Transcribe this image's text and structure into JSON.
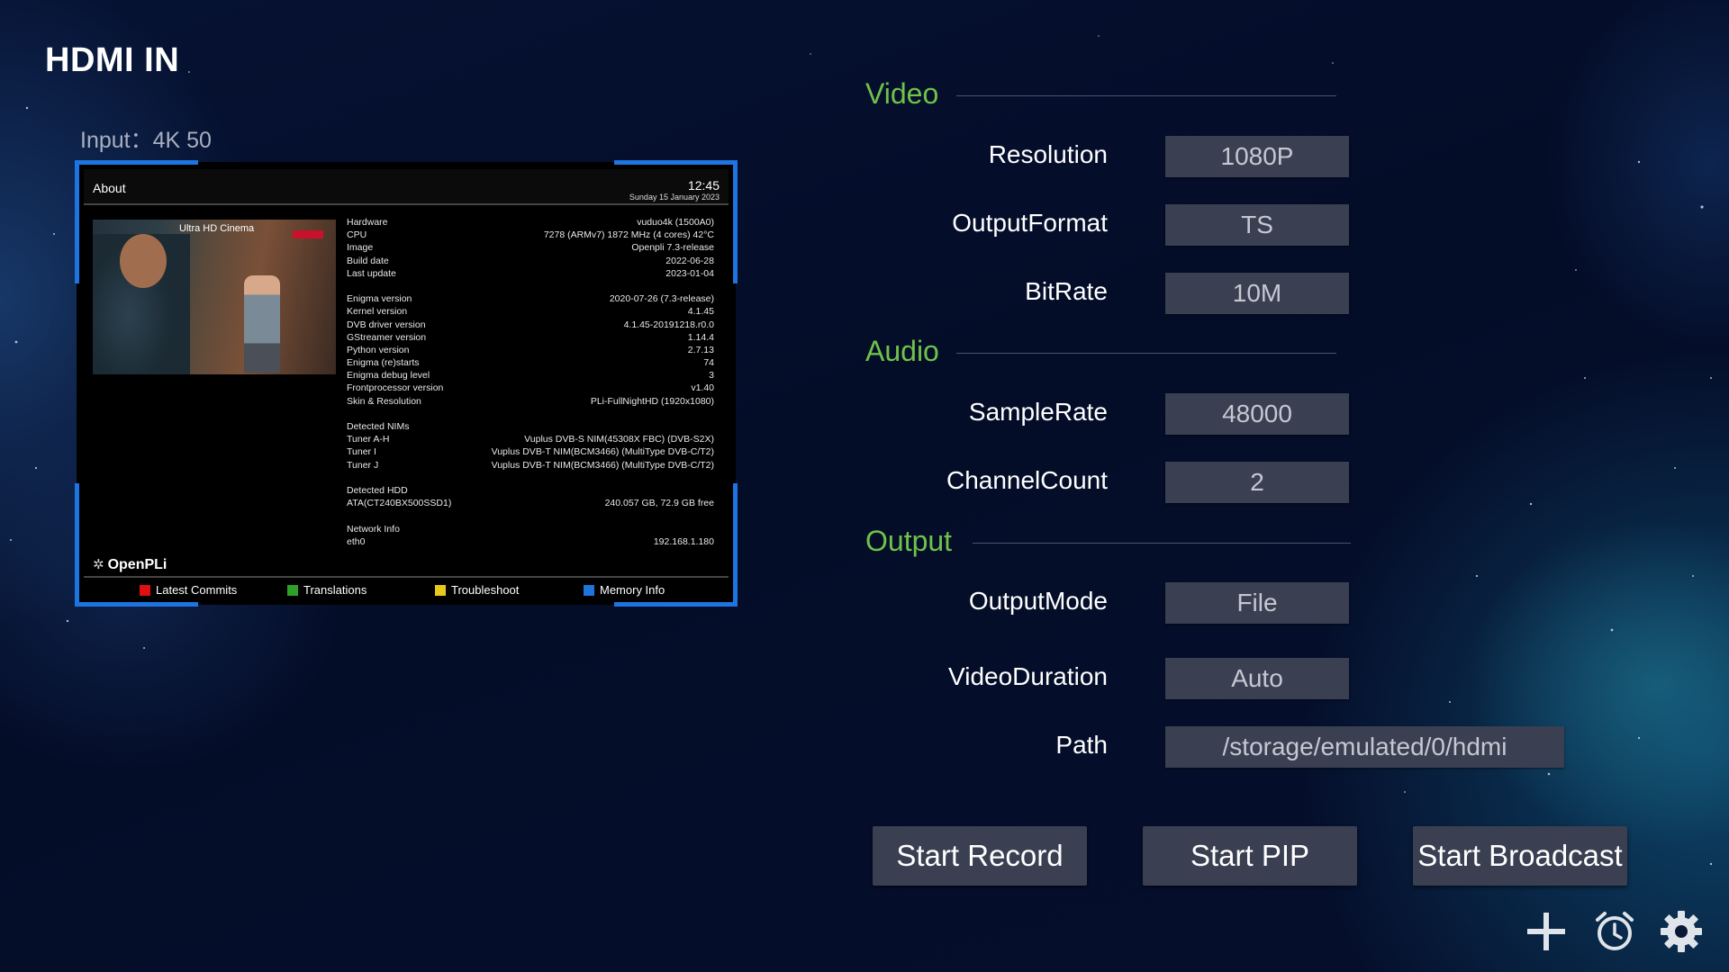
{
  "app": {
    "title": "HDMI IN",
    "input_label": "Input：4K 50"
  },
  "preview": {
    "header": {
      "title": "About",
      "time": "12:45",
      "date": "Sunday 15 January 2023"
    },
    "thumbnail": {
      "caption": "Ultra HD Cinema"
    },
    "info": [
      {
        "k": "Hardware",
        "v": "vuduo4k (1500A0)"
      },
      {
        "k": "CPU",
        "v": "7278 (ARMv7) 1872 MHz (4 cores) 42°C"
      },
      {
        "k": "Image",
        "v": "Openpli 7.3-release"
      },
      {
        "k": "Build date",
        "v": "2022-06-28"
      },
      {
        "k": "Last update",
        "v": "2023-01-04"
      },
      {
        "k": "Enigma version",
        "v": "2020-07-26 (7.3-release)"
      },
      {
        "k": "Kernel version",
        "v": "4.1.45"
      },
      {
        "k": "DVB driver version",
        "v": "4.1.45-20191218.r0.0"
      },
      {
        "k": "GStreamer version",
        "v": "1.14.4"
      },
      {
        "k": "Python version",
        "v": "2.7.13"
      },
      {
        "k": "Enigma (re)starts",
        "v": "74"
      },
      {
        "k": "Enigma debug level",
        "v": "3"
      },
      {
        "k": "Frontprocessor version",
        "v": "v1.40"
      },
      {
        "k": "Skin & Resolution",
        "v": "PLi-FullNightHD (1920x1080)"
      },
      {
        "k": "Detected NIMs",
        "v": ""
      },
      {
        "k": "Tuner A-H",
        "v": "Vuplus DVB-S NIM(45308X FBC) (DVB-S2X)"
      },
      {
        "k": "Tuner I",
        "v": "Vuplus DVB-T NIM(BCM3466) (MultiType DVB-C/T2)"
      },
      {
        "k": "Tuner J",
        "v": "Vuplus DVB-T NIM(BCM3466) (MultiType DVB-C/T2)"
      },
      {
        "k": "Detected HDD",
        "v": ""
      },
      {
        "k": "ATA(CT240BX500SSD1)",
        "v": "240.057 GB, 72.9 GB free"
      },
      {
        "k": "Network Info",
        "v": ""
      },
      {
        "k": "eth0",
        "v": "192.168.1.180"
      }
    ],
    "logo": "OpenPLi",
    "footer": [
      {
        "label": "Latest Commits",
        "color": "#e01010"
      },
      {
        "label": "Translations",
        "color": "#2ea02a"
      },
      {
        "label": "Troubleshoot",
        "color": "#e8c81a"
      },
      {
        "label": "Memory Info",
        "color": "#1e74d8"
      }
    ]
  },
  "sections": {
    "video": "Video",
    "audio": "Audio",
    "output": "Output"
  },
  "settings": {
    "resolution": {
      "label": "Resolution",
      "value": "1080P"
    },
    "output_format": {
      "label": "OutputFormat",
      "value": "TS"
    },
    "bitrate": {
      "label": "BitRate",
      "value": "10M"
    },
    "sample_rate": {
      "label": "SampleRate",
      "value": "48000"
    },
    "channel_count": {
      "label": "ChannelCount",
      "value": "2"
    },
    "output_mode": {
      "label": "OutputMode",
      "value": "File"
    },
    "video_duration": {
      "label": "VideoDuration",
      "value": "Auto"
    },
    "path": {
      "label": "Path",
      "value": "/storage/emulated/0/hdmi"
    }
  },
  "buttons": {
    "start_record": "Start Record",
    "start_pip": "Start PIP",
    "start_broadcast": "Start Broadcast"
  },
  "icons": [
    "plus-icon",
    "alarm-clock-icon",
    "gear-icon"
  ],
  "colors": {
    "accent_green": "#6fc24a",
    "field_bg": "#3a4052",
    "preview_border": "#1e74e0"
  }
}
